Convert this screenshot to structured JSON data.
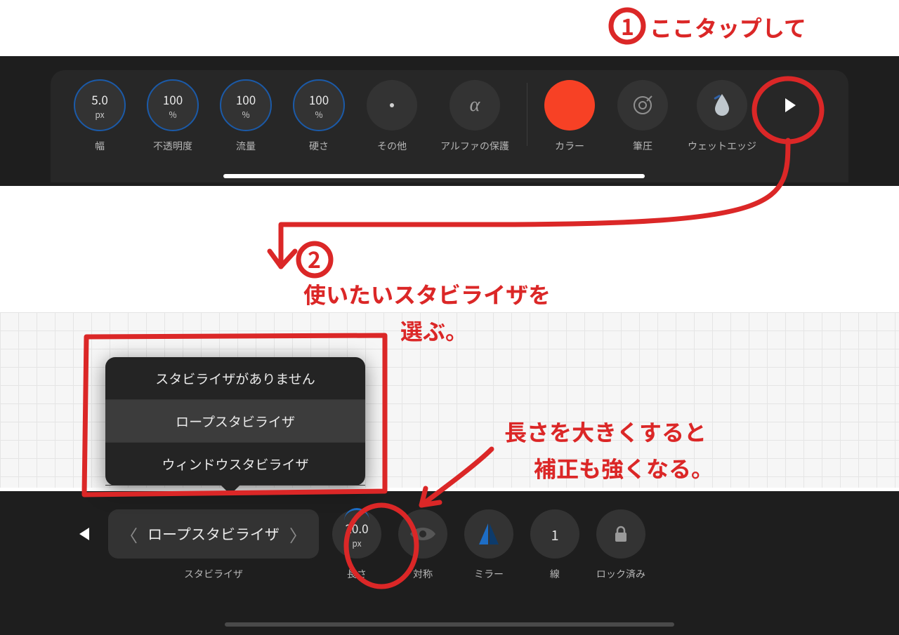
{
  "colors": {
    "accent_ring": "#1b5aa8",
    "brush_color": "#f74125",
    "annotation": "#db2727"
  },
  "top_toolbar": {
    "items": [
      {
        "value": "5.0",
        "unit": "px",
        "label": "幅",
        "ring": true
      },
      {
        "value": "100",
        "unit": "%",
        "label": "不透明度",
        "ring": true
      },
      {
        "value": "100",
        "unit": "%",
        "label": "流量",
        "ring": true
      },
      {
        "value": "100",
        "unit": "%",
        "label": "硬さ",
        "ring": true
      },
      {
        "icon": "dot",
        "label": "その他"
      },
      {
        "icon": "alpha",
        "label": "アルファの保護"
      },
      {
        "icon": "color",
        "label": "カラー"
      },
      {
        "icon": "target",
        "label": "筆圧"
      },
      {
        "icon": "wetedge",
        "label": "ウェットエッジ"
      }
    ],
    "more_arrow_direction": "right"
  },
  "stabilizer_popup": {
    "items": [
      {
        "label": "スタビライザがありません",
        "selected": false
      },
      {
        "label": "ロープスタビライザ",
        "selected": true
      },
      {
        "label": "ウィンドウスタビライザ",
        "selected": false
      }
    ]
  },
  "bottom_toolbar": {
    "back_arrow_direction": "left",
    "stabilizer": {
      "label": "スタビライザ",
      "value": "ロープスタビライザ"
    },
    "length": {
      "label": "長さ",
      "value": "20.0",
      "unit": "px"
    },
    "symmetry": {
      "label": "対称"
    },
    "mirror": {
      "label": "ミラー"
    },
    "lines": {
      "label": "線",
      "value": "1"
    },
    "lock": {
      "label": "ロック済み"
    }
  },
  "annotations": {
    "step1_number": "1",
    "step1_text": "ここタップして",
    "step2_number": "2",
    "step2a": "使いたいスタビライザを",
    "step2b": "選ぶ。",
    "tip_a": "長さを大きくすると",
    "tip_b": "補正も強くなる。"
  }
}
